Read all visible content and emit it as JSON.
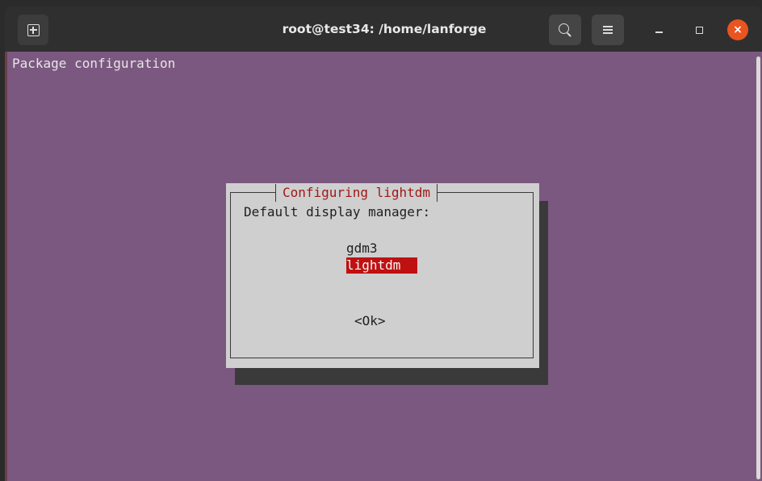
{
  "window": {
    "title": "root@test34: /home/lanforge",
    "close_glyph": "×"
  },
  "icons": {
    "new_tab": "new-tab-icon",
    "search": "search-icon",
    "menu": "hamburger-menu-icon",
    "minimize": "minimize-icon",
    "maximize": "maximize-icon",
    "close": "close-icon"
  },
  "colors": {
    "terminal_bg": "#7b5880",
    "dialog_bg": "#cfcfcf",
    "dialog_title": "#a11818",
    "selection_bg": "#bf1111",
    "close_button": "#e95420"
  },
  "terminal": {
    "heading": "Package configuration"
  },
  "dialog": {
    "title": "Configuring lightdm",
    "prompt": "Default display manager:",
    "options": [
      "gdm3",
      "lightdm"
    ],
    "selected": "lightdm",
    "ok_label": "<Ok>"
  }
}
